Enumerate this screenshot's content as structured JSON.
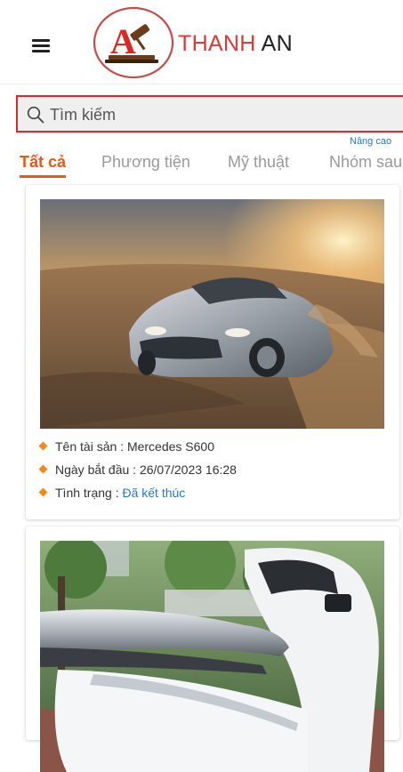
{
  "header": {
    "brand_primary": "THANH",
    "brand_secondary": "AN",
    "menu_icon": "hamburger-icon",
    "logo_icon": "gavel-logo",
    "accent_color": "#e25a1c",
    "brand_red": "#d83b39"
  },
  "search": {
    "placeholder": "Tìm kiếm",
    "value": "",
    "icon": "search-icon",
    "advanced_label": "Nâng cao"
  },
  "tabs": [
    {
      "label": "Tất cả",
      "active": true
    },
    {
      "label": "Phương tiện",
      "active": false
    },
    {
      "label": "Mỹ thuật",
      "active": false
    },
    {
      "label": "Nhóm sau",
      "active": false
    }
  ],
  "cards": [
    {
      "image": "sports-car-photo",
      "name_label": "Tên tài sản :",
      "name_value": "Mercedes S600",
      "date_label": "Ngày bắt đầu :",
      "date_value": "26/07/2023 16:28",
      "status_label": "Tình trạng :",
      "status_value": "Đã kết thúc"
    },
    {
      "image": "scooter-photo"
    }
  ]
}
